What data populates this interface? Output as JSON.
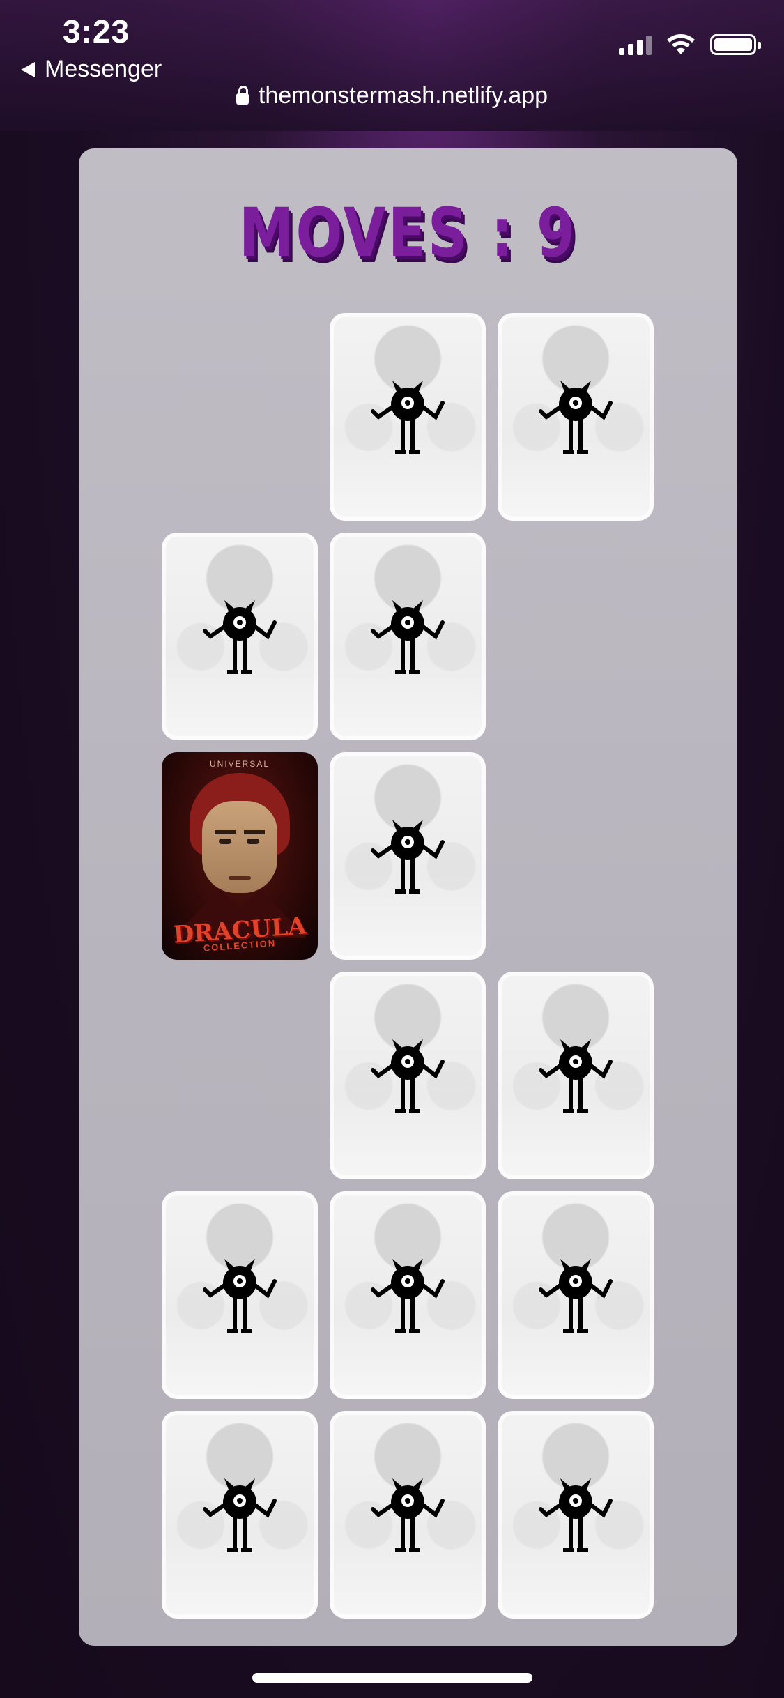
{
  "status_bar": {
    "time": "3:23",
    "back_app": "Messenger"
  },
  "browser": {
    "url": "themonstermash.netlify.app"
  },
  "game": {
    "moves_label": "MOVES : 9",
    "card_back_icon": "one-eyed-monster-icon",
    "face_up_card": {
      "top_text": "UNIVERSAL",
      "title": "DRACULA",
      "subtitle": "COLLECTION"
    },
    "grid": [
      [
        "empty",
        "down",
        "down"
      ],
      [
        "down",
        "down",
        "empty"
      ],
      [
        "face",
        "down",
        "empty"
      ],
      [
        "empty",
        "down",
        "down"
      ],
      [
        "down",
        "down",
        "down"
      ],
      [
        "down",
        "down",
        "down"
      ]
    ]
  },
  "colors": {
    "moves_text": "#7a1e9c",
    "board": "#b9b5be",
    "background": "#1a0c22"
  }
}
